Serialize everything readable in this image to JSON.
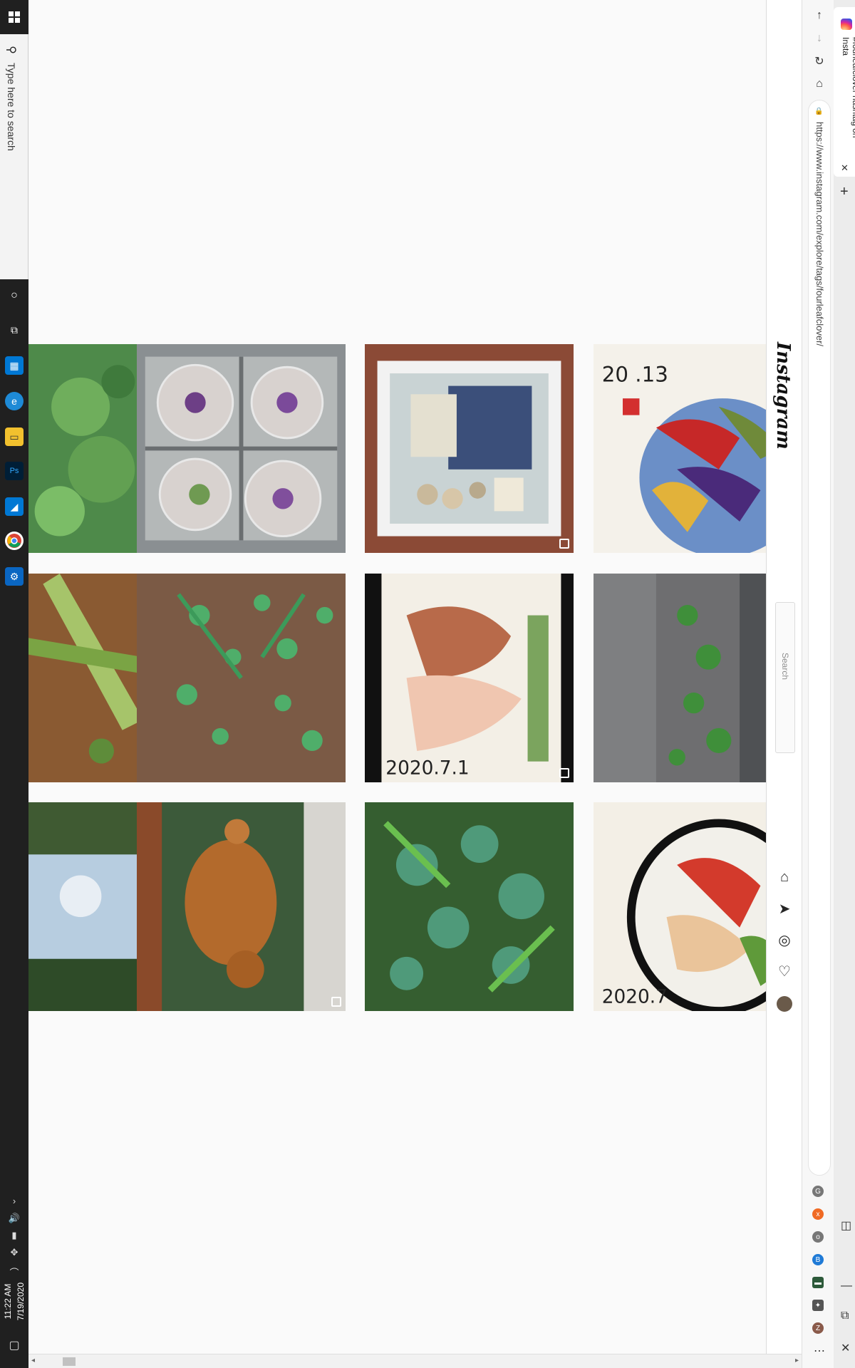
{
  "taskbar": {
    "search_placeholder": "Type here to search",
    "clock_time": "11:22 AM",
    "clock_date": "7/19/2020",
    "pinned_apps": [
      "store-icon",
      "edge-icon",
      "file-explorer-icon",
      "photoshop-icon",
      "azure-data-studio-icon",
      "chrome-icon",
      "settings-icon"
    ]
  },
  "browser": {
    "tab_title": "#fourleafclover hashtag on Insta",
    "url": "https://www.instagram.com/explore/tags/fourleafclover/",
    "extensions": [
      "G",
      "x",
      "o",
      "B",
      "▬",
      "✦",
      "Z"
    ]
  },
  "instagram": {
    "logo": "Instagram",
    "search_placeholder": "Search",
    "nav_icons": [
      "home-icon",
      "direct-icon",
      "explore-icon",
      "activity-icon",
      "profile-avatar"
    ],
    "grid_posts": [
      {
        "id": "clover-close",
        "multi": false
      },
      {
        "id": "resin-coasters",
        "multi": false
      },
      {
        "id": "shadow-box",
        "multi": true
      },
      {
        "id": "painting-peppers",
        "multi": false
      },
      {
        "id": "weeds-soil",
        "multi": false
      },
      {
        "id": "pine-needles-clover",
        "multi": false
      },
      {
        "id": "painting-bread",
        "multi": true
      },
      {
        "id": "clover-roadside",
        "multi": false
      },
      {
        "id": "trees-sky",
        "multi": false
      },
      {
        "id": "dog-window",
        "multi": true
      },
      {
        "id": "clover-patch",
        "multi": false
      },
      {
        "id": "painting-food",
        "multi": false
      }
    ],
    "painting_texts": {
      "peppers": "20 .13",
      "bread": "2020.7.1",
      "food": "2020.7"
    }
  }
}
